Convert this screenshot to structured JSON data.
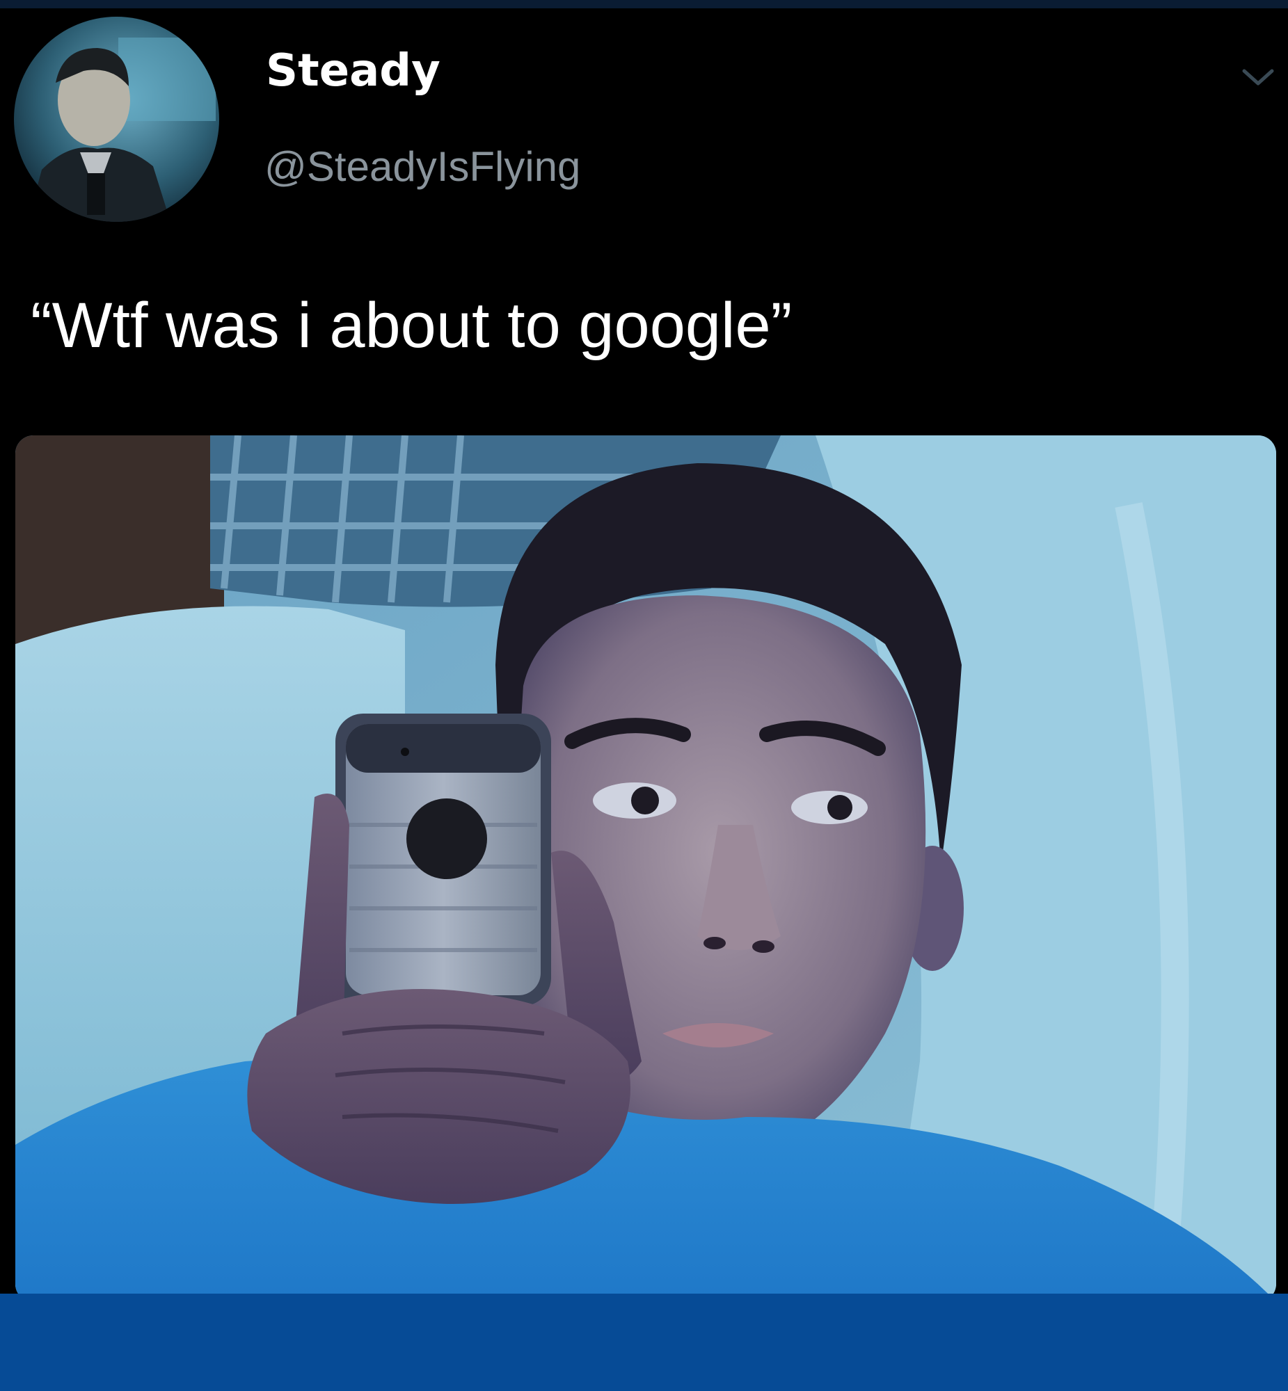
{
  "tweet": {
    "display_name": "Steady",
    "handle": "@SteadyIsFlying",
    "text": "“Wtf was i about to google”",
    "avatar_icon": "profile-photo",
    "menu_icon": "chevron-down-icon",
    "media_description_icon": "attached-photo"
  },
  "colors": {
    "background": "#000000",
    "name": "#ffffff",
    "handle": "#8a949c",
    "bottom_bar": "#064b96"
  }
}
